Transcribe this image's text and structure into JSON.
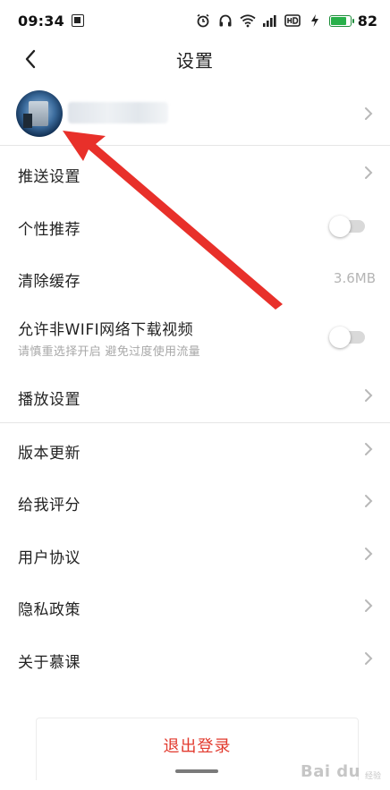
{
  "status_bar": {
    "time": "09:34",
    "battery_level": "82",
    "battery_percent": 0.82,
    "battery_color": "#28b04a",
    "icons": [
      "sim-icon",
      "alarm-icon",
      "headphone-icon",
      "wifi-icon",
      "signal-icon",
      "hd-icon",
      "charging-icon",
      "battery-icon"
    ]
  },
  "nav": {
    "title": "设置",
    "back_icon": "chevron-left-icon"
  },
  "profile": {
    "avatar": "avatar-image",
    "name": ""
  },
  "settings": {
    "push_settings": "推送设置",
    "personal_recommend": {
      "label": "个性推荐",
      "enabled": false
    },
    "clear_cache": {
      "label": "清除缓存",
      "value": "3.6MB"
    },
    "allow_non_wifi": {
      "label": "允许非WIFI网络下载视频",
      "sublabel": "请慎重选择开启 避免过度使用流量",
      "enabled": false
    },
    "playback_settings": "播放设置",
    "version_update": "版本更新",
    "rate_us": "给我评分",
    "user_agreement": "用户协议",
    "privacy_policy": "隐私政策",
    "about": "关于慕课"
  },
  "logout": {
    "label": "退出登录",
    "color": "#e23a2e"
  },
  "watermark": {
    "logo": "Bai du",
    "sub": "经验"
  },
  "annotation": {
    "color": "#e8302a",
    "icon": "red-arrow-annotation"
  }
}
